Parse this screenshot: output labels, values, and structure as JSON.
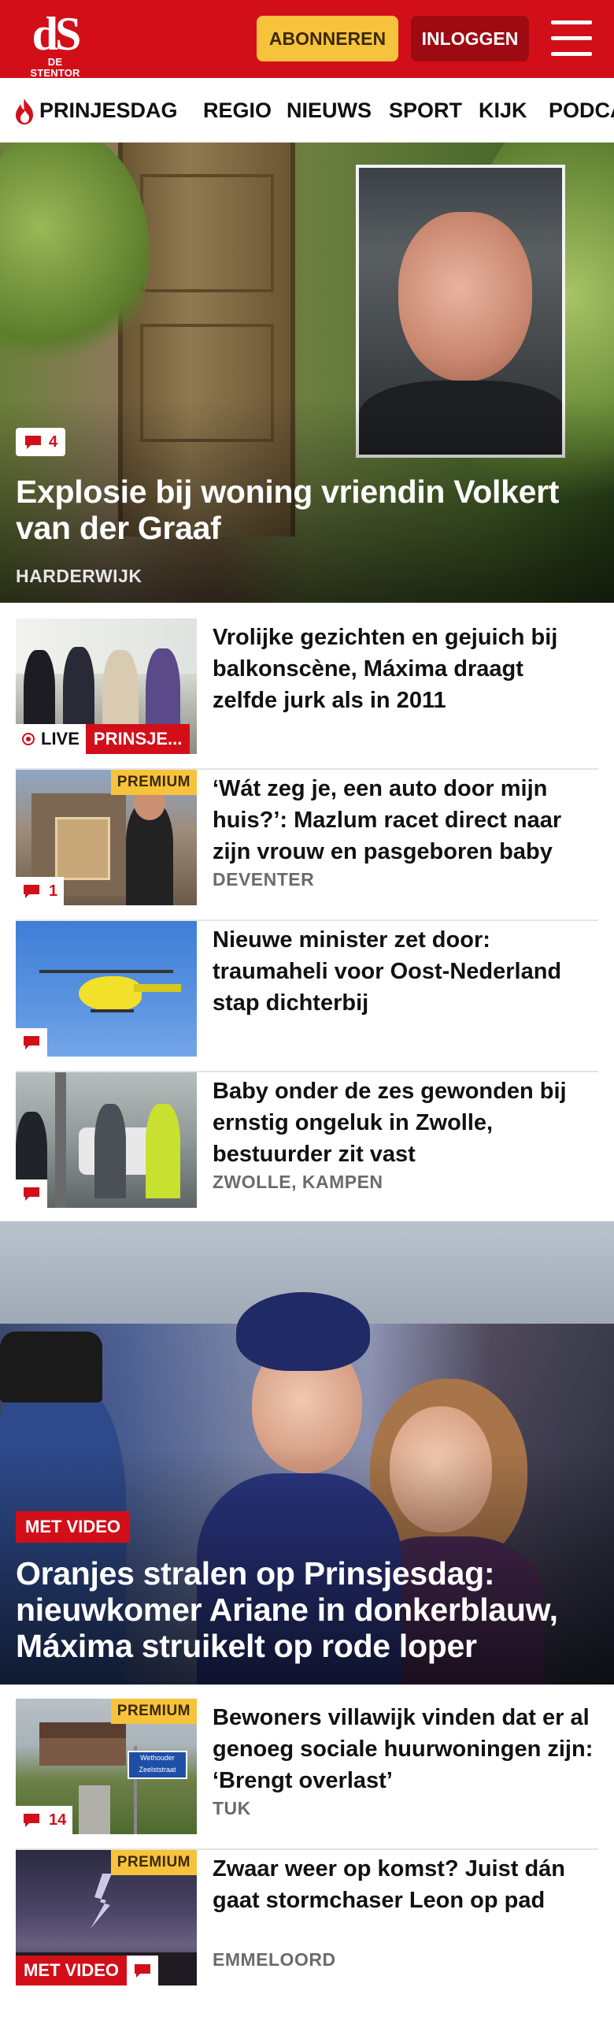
{
  "header": {
    "logo_mark": "dS",
    "logo_sub": "DE STENTOR",
    "subscribe_label": "ABONNEREN",
    "login_label": "INLOGGEN",
    "menu_icon": "hamburger-menu-icon",
    "brand_color": "#d20f19"
  },
  "nav": {
    "items": [
      {
        "label": "PRINJESDAG"
      },
      {
        "label": "REGIO"
      },
      {
        "label": "NIEUWS"
      },
      {
        "label": "SPORT"
      },
      {
        "label": "KIJK"
      },
      {
        "label": "PODCA"
      }
    ],
    "trending_icon": "flame-icon"
  },
  "top_story": {
    "comments": "4",
    "title": "Explosie bij woning vriendin Volkert van der Graaf",
    "location": "HARDERWIJK"
  },
  "articles": [
    {
      "title": "Vrolijke gezichten en gejuich bij balkonscène, Máxima draagt zelfde jurk als in 2011",
      "live_label": "LIVE",
      "tag": "PRINSJE..."
    },
    {
      "title": "‘Wát zeg je, een auto door mijn huis?’: Mazlum racet direct naar zijn vrouw en pasgeboren baby",
      "location": "DEVENTER",
      "premium": "PREMIUM",
      "comments": "1"
    },
    {
      "title": "Nieuwe minister zet door: traumaheli voor Oost-Nederland stap dichterbij"
    },
    {
      "title": "Baby onder de zes gewonden bij ernstig ongeluk in Zwolle, bestuurder zit vast",
      "location": "ZWOLLE, KAMPEN"
    }
  ],
  "second_story": {
    "tag": "MET VIDEO",
    "title": "Oranjes stralen op Prinsjesdag: nieuwkomer Ariane in donkerblauw, Máxima struikelt op rode loper"
  },
  "articles2": [
    {
      "title": "Bewoners villawijk vinden dat er al genoeg sociale huurwoningen zijn: ‘Brengt overlast’",
      "location": "TUK",
      "premium": "PREMIUM",
      "comments": "14",
      "sign_text_1": "Wethouder",
      "sign_text_2": "Zeelststraat"
    },
    {
      "title": "Zwaar weer op komst? Juist dán gaat stormchaser Leon op pad",
      "location": "EMMELOORD",
      "premium": "PREMIUM",
      "video_tag": "MET VIDEO"
    }
  ]
}
